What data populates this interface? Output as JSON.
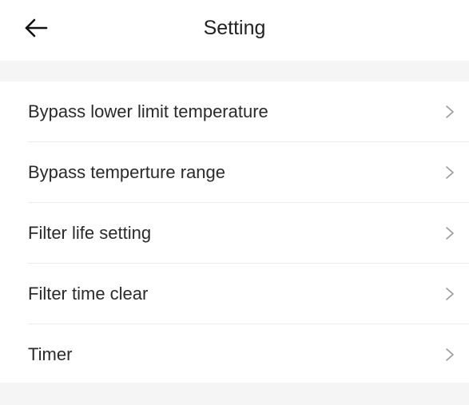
{
  "header": {
    "title": "Setting",
    "back_icon": "arrow-left-icon"
  },
  "settings": {
    "items": [
      {
        "label": "Bypass lower limit temperature",
        "icon": "chevron-right-icon"
      },
      {
        "label": "Bypass temperture range",
        "icon": "chevron-right-icon"
      },
      {
        "label": "Filter life setting",
        "icon": "chevron-right-icon"
      },
      {
        "label": "Filter time clear",
        "icon": "chevron-right-icon"
      },
      {
        "label": "Timer",
        "icon": "chevron-right-icon"
      }
    ]
  },
  "colors": {
    "background": "#ffffff",
    "section_gap": "#f5f5f5",
    "divider": "#ececec",
    "text": "#2a2a2a",
    "chevron": "#9a9a9a"
  }
}
